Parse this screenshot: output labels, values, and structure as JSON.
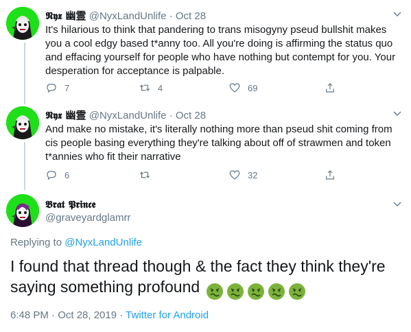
{
  "tweets": [
    {
      "name": "𝕹𝖞𝖝 幽霊",
      "handle": "@NyxLandUnlife",
      "dot": "·",
      "date": "Oct 28",
      "text": "It's hilarious to think that pandering to trans misogyny pseud bullshit makes you a cool edgy based t*anny too. All you're doing is affirming the status quo and effacing yourself for people who have nothing but contempt for you. Your desperation for acceptance is palpable.",
      "replies": "7",
      "retweets": "4",
      "likes": "69"
    },
    {
      "name": "𝕹𝖞𝖝 幽霊",
      "handle": "@NyxLandUnlife",
      "dot": "·",
      "date": "Oct 28",
      "text": "And make no mistake, it's literally nothing more than pseud shit coming from cis people basing everything they're talking about off of strawmen and token t*annies who fit their narrative",
      "replies": "6",
      "retweets": "",
      "likes": "32"
    }
  ],
  "main": {
    "name": "𝕭𝖗𝖆𝖙 𝕻𝖗𝖎𝖓𝖈𝖊",
    "handle": "@graveyardglamrr",
    "replying_prefix": "Replying to ",
    "replying_to": "@NyxLandUnlife",
    "text": "I found that thread though & the fact they think they're saying something profound",
    "emoji_name": "nauseated-face",
    "emoji_count": 5,
    "time": "6:48 PM · Oct 28, 2019 · ",
    "source": "Twitter for Android"
  },
  "icons": {
    "reply": "reply-icon",
    "retweet": "retweet-icon",
    "like": "heart-icon",
    "share": "share-icon",
    "more": "chevron-down-icon"
  },
  "colors": {
    "link": "#1da1f2",
    "secondary": "#657786",
    "avatar_bg": "#1ee018",
    "emoji_face": "#7bb33a"
  }
}
